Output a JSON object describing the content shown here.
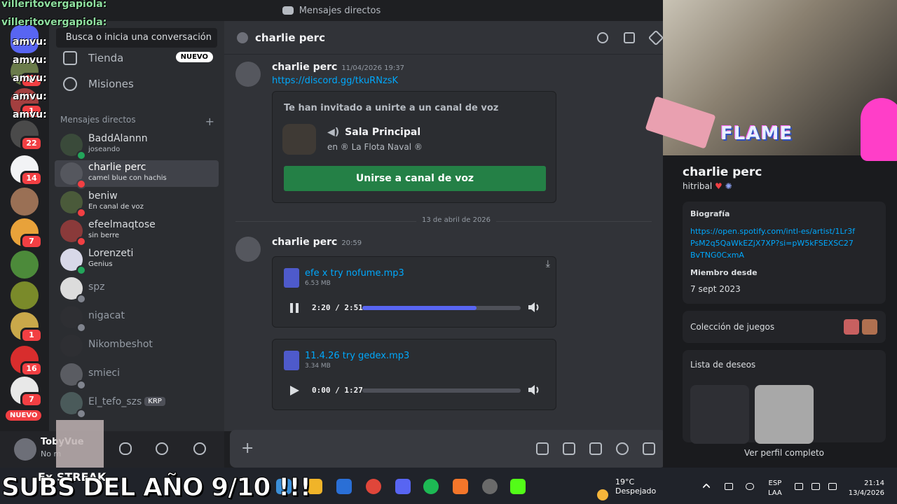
{
  "window": {
    "title": "Mensajes directos"
  },
  "sidebar": {
    "search_placeholder": "Busca o inicia una conversación",
    "nav": [
      {
        "label": "Tienda",
        "badge": "NUEVO"
      },
      {
        "label": "Misiones"
      }
    ],
    "dm_header": "Mensajes directos",
    "dm_add": "+",
    "dms": [
      {
        "name": "BaddAlannn",
        "sub": "joseando",
        "tag": ""
      },
      {
        "name": "charlie perc",
        "sub": "camel blue con hachis",
        "tag": ""
      },
      {
        "name": "beniw",
        "sub": "En canal de voz",
        "tag": ""
      },
      {
        "name": "efeelmaqtose",
        "sub": "sin berre",
        "tag": ""
      },
      {
        "name": "Lorenzeti",
        "sub": "Genius",
        "tag": ""
      },
      {
        "name": "spz",
        "sub": "",
        "tag": ""
      },
      {
        "name": "nigacat",
        "sub": "",
        "tag": ""
      },
      {
        "name": "Nikombeshot",
        "sub": "",
        "tag": ""
      },
      {
        "name": "smieci",
        "sub": "",
        "tag": ""
      },
      {
        "name": "El_tefo_szs",
        "sub": "",
        "tag": "KRP"
      }
    ]
  },
  "rail": {
    "badges": [
      "6",
      "1",
      "22",
      "14",
      "7",
      "1",
      "16",
      "7"
    ],
    "nuevo": "NUEVO"
  },
  "user_panel": {
    "name": "TobyVue",
    "status": "No m"
  },
  "chat": {
    "header_name": "charlie perc",
    "msg1": {
      "author": "charlie perc",
      "time": "11/04/2026 19:37",
      "link": "https://discord.gg/tkuRNzsK",
      "invite": {
        "title": "Te han invitado a unirte a un canal de voz",
        "channel": "Sala Principal",
        "server": "en ® La Flota Naval ®",
        "button": "Unirse a canal de voz"
      }
    },
    "date_divider": "13 de abril de 2026",
    "msg2": {
      "author": "charlie perc",
      "time": "20:59",
      "files": [
        {
          "name": "efe x try nofume.mp3",
          "size": "6.53 MB",
          "time": "2:20 / 2:51",
          "progress": 0.72,
          "playing": true
        },
        {
          "name": "11.4.26 try gedex.mp3",
          "size": "3.34 MB",
          "time": "0:00 / 1:27",
          "progress": 0.0,
          "playing": false
        }
      ]
    },
    "composer_plus": "+"
  },
  "profile": {
    "banner_text": "FLAME",
    "name": "charlie perc",
    "username": "hitribal",
    "bio_label": "Biografía",
    "bio_link": "https://open.spotify.com/intl-es/artist/1Lr3fPsM2q5QaWkEZjX7XP?si=pW5kFSEXSC27BvTNG0CxmA",
    "member_label": "Miembro desde",
    "member_since": "7 sept 2023",
    "games_label": "Colección de juegos",
    "wishlist_label": "Lista de deseos",
    "full_profile": "Ver perfil completo"
  },
  "taskbar": {
    "temp": "19°C",
    "weather": "Despejado",
    "lang1": "ESP",
    "lang2": "LAA",
    "time": "21:14",
    "date": "13/4/2026"
  },
  "stream_overlay": {
    "chat_lines": [
      "villeritovergapiola:",
      "villeritovergapiola:",
      "amvu:",
      "amvu:",
      "amvu:",
      "amvu:",
      "amvu:"
    ],
    "subs_text": "SUBS DEL AÑO 9/10 !!!",
    "streak_text": "Ex STREAK"
  },
  "colors": {
    "accent": "#5865f2",
    "join_green": "#248046",
    "link": "#00a8fc",
    "badge_red": "#f23f43"
  }
}
